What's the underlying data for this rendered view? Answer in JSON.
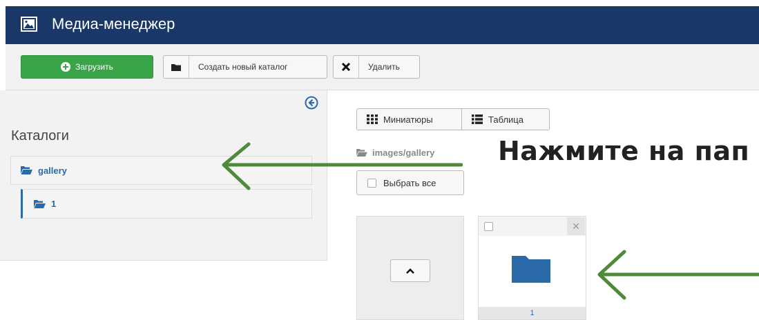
{
  "header": {
    "title": "Медиа-менеджер",
    "icon": "image-icon"
  },
  "toolbar": {
    "upload_label": "Загрузить",
    "new_dir_label": "Создать новый каталог",
    "delete_label": "Удалить"
  },
  "sidebar": {
    "heading": "Каталоги",
    "items": [
      {
        "label": "gallery"
      },
      {
        "label": "1"
      }
    ]
  },
  "main": {
    "views": {
      "thumbnails": "Миниатюры",
      "table": "Таблица"
    },
    "path": "images/gallery",
    "select_all": "Выбрать все",
    "folder_tile": {
      "name": "1"
    }
  },
  "overlay": {
    "text": "Нажмите на пап"
  },
  "colors": {
    "header_bg": "#1a3867",
    "upload_green": "#3aa548",
    "folder_blue": "#2a6aa8",
    "arrow_green": "#4f8a3a"
  }
}
